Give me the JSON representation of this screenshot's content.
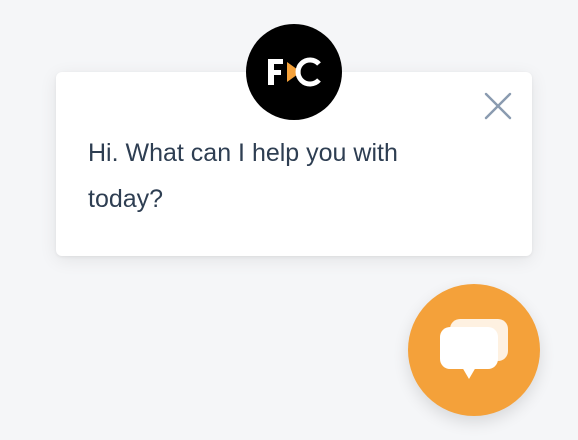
{
  "chat_popup": {
    "greeting": "Hi. What can I help you with today?",
    "close_icon": "close-icon",
    "avatar_logo_text": "FC"
  },
  "launcher": {
    "icon": "chat-bubbles-icon"
  },
  "colors": {
    "background": "#f5f6f8",
    "card": "#ffffff",
    "text": "#2e3e52",
    "close_icon": "#8a9bb0",
    "avatar_bg": "#000000",
    "logo_accent": "#f4a13a",
    "launcher_bg": "#f4a13a"
  }
}
